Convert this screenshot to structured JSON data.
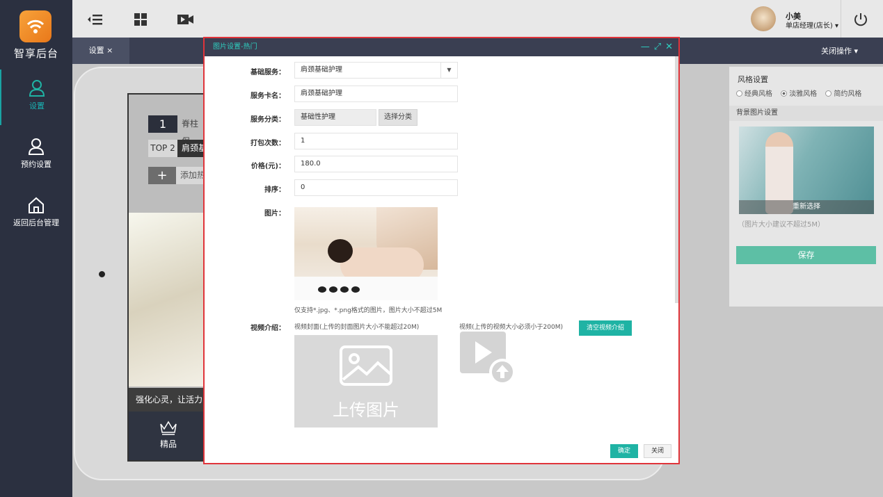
{
  "brand": {
    "name": "智享后台"
  },
  "sidebar": {
    "items": [
      {
        "label": "设置",
        "icon": "user-icon",
        "active": true
      },
      {
        "label": "预约设置",
        "icon": "user-icon"
      },
      {
        "label": "返回后台管理",
        "icon": "home-icon"
      }
    ]
  },
  "topbar": {
    "user_name": "小美",
    "user_role": "单店经理(店长) ▾"
  },
  "tabs": {
    "current": "设置 ×",
    "close_ops": "关闭操作 ▾"
  },
  "preview": {
    "hot1_rank": "1",
    "hot1_text": "脊柱保",
    "hot2_rank": "TOP 2",
    "hot2_text": "肩颈基",
    "add_hot_symbol": "+",
    "add_hot_text": "添加热",
    "slogan": "强化心灵，让活力",
    "nav_label": "精品"
  },
  "style_panel": {
    "title": "风格设置",
    "options": [
      {
        "label": "经典风格",
        "selected": false
      },
      {
        "label": "淡雅风格",
        "selected": true
      },
      {
        "label": "简约风格",
        "selected": false
      }
    ],
    "bg_title": "背景图片设置",
    "reselect": "重新选择",
    "size_hint": "（图片大小建议不超过5M）",
    "save": "保存"
  },
  "modal": {
    "title": "图片设置-热门",
    "fields": {
      "base_service_label": "基础服务：",
      "base_service_value": "肩颈基础护理",
      "card_name_label": "服务卡名：",
      "card_name_value": "肩颈基础护理",
      "category_label": "服务分类：",
      "category_value": "基础性护理",
      "choose_category": "选择分类",
      "pack_count_label": "打包次数：",
      "pack_count_value": "1",
      "price_label": "价格(元)：",
      "price_value": "180.0",
      "sort_label": "排序：",
      "sort_value": "0",
      "image_label": "图片：",
      "image_hint": "仅支持*.jpg、*.png格式的图片，图片大小不超过5M",
      "video_label": "视频介绍：",
      "cover_hint": "视频封面(上传的封面图片大小不能超过20M)",
      "video_hint": "视频(上传的视频大小必须小于200M)",
      "clear_video": "清空视频介绍",
      "upload_image": "上传图片"
    },
    "confirm": "确定",
    "close": "关闭"
  },
  "colors": {
    "sidebar_bg": "#2b3040",
    "accent_teal": "#1fb3a4",
    "modal_border": "#e0343a",
    "save_green": "#5dbfa5"
  }
}
